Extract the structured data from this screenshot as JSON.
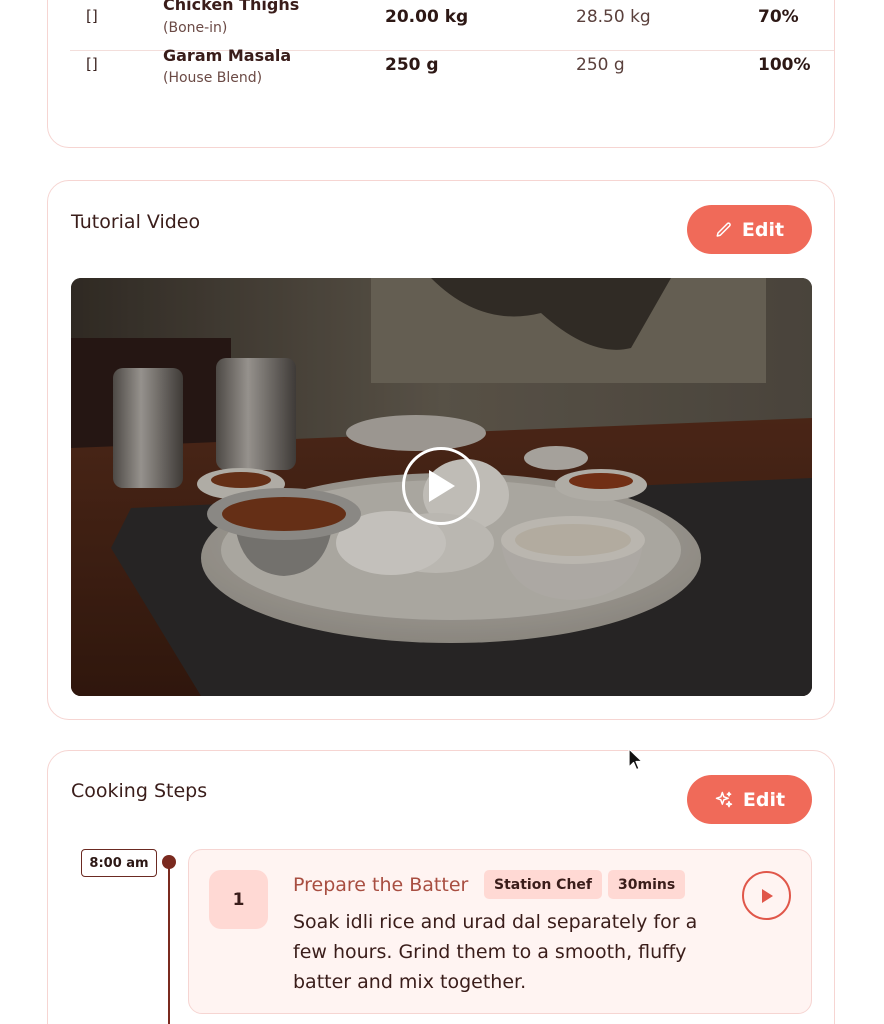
{
  "ingredients": {
    "rows": [
      {
        "checkbox": "[]",
        "name": "Chicken Thighs",
        "note": "(Bone-in)",
        "planned_qty": "20.00 kg",
        "actual_qty": "28.50 kg",
        "percent": "70%"
      },
      {
        "checkbox": "[]",
        "name": "Garam Masala",
        "note": "(House Blend)",
        "planned_qty": "250 g",
        "actual_qty": "250 g",
        "percent": "100%"
      }
    ]
  },
  "tutorial": {
    "title": "Tutorial Video",
    "edit_label": "Edit",
    "edit_icon": "pencil-icon",
    "video_play_icon": "play-icon"
  },
  "steps": {
    "title": "Cooking Steps",
    "edit_label": "Edit",
    "edit_icon": "sparkle-icon",
    "items": [
      {
        "time": "8:00 am",
        "number": "1",
        "title": "Prepare the Batter",
        "role": "Station Chef",
        "duration": "30mins",
        "description": "Soak idli rice and urad dal separately for a few hours. Grind them to a smooth, fluffy batter and mix together."
      }
    ]
  },
  "colors": {
    "accent": "#f06a59",
    "card_border": "#f6d5d2",
    "tag_bg": "#ffd9d4",
    "timeline": "#7a2a1f",
    "step_title": "#a84e41"
  }
}
